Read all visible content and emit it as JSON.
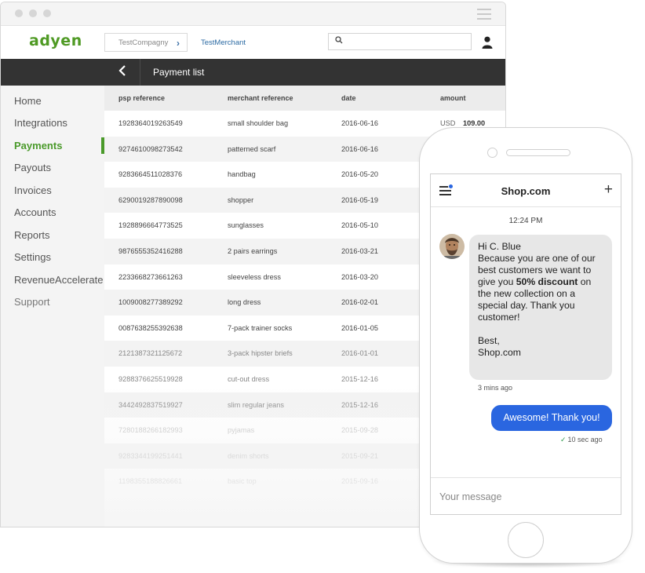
{
  "header": {
    "logo": "adyen",
    "company": "TestCompagny",
    "merchant": "TestMerchant",
    "search_value": "",
    "search_placeholder": ""
  },
  "page": {
    "title": "Payment list"
  },
  "sidebar": {
    "items": [
      {
        "label": "Home"
      },
      {
        "label": "Integrations"
      },
      {
        "label": "Payments"
      },
      {
        "label": "Payouts"
      },
      {
        "label": "Invoices"
      },
      {
        "label": "Accounts"
      },
      {
        "label": "Reports"
      },
      {
        "label": "Settings"
      },
      {
        "label": "RevenueAccelerate"
      },
      {
        "label": "Support"
      }
    ],
    "active_index": 2
  },
  "table": {
    "columns": [
      "psp reference",
      "merchant reference",
      "date",
      "amount"
    ],
    "rows": [
      {
        "psp": "1928364019263549",
        "ref": "small shoulder bag",
        "date": "2016-06-16",
        "currency": "USD",
        "amount": "109.00"
      },
      {
        "psp": "9274610098273542",
        "ref": "patterned scarf",
        "date": "2016-06-16"
      },
      {
        "psp": "9283664511028376",
        "ref": "handbag",
        "date": "2016-05-20"
      },
      {
        "psp": "6290019287890098",
        "ref": "shopper",
        "date": "2016-05-19"
      },
      {
        "psp": "1928896664773525",
        "ref": "sunglasses",
        "date": "2016-05-10"
      },
      {
        "psp": "9876555352416288",
        "ref": "2 pairs earrings",
        "date": "2016-03-21"
      },
      {
        "psp": "2233668273661263",
        "ref": "sleeveless dress",
        "date": "2016-03-20"
      },
      {
        "psp": "1009008277389292",
        "ref": "long dress",
        "date": "2016-02-01"
      },
      {
        "psp": "0087638255392638",
        "ref": "7-pack trainer socks",
        "date": "2016-01-05"
      },
      {
        "psp": "2121387321125672",
        "ref": "3-pack hipster briefs",
        "date": "2016-01-01"
      },
      {
        "psp": "9288376625519928",
        "ref": "cut-out dress",
        "date": "2015-12-16"
      },
      {
        "psp": "3442492837519927",
        "ref": "slim regular jeans",
        "date": "2015-12-16"
      },
      {
        "psp": "7280188266182993",
        "ref": "pyjamas",
        "date": "2015-09-28"
      },
      {
        "psp": "9283344199251441",
        "ref": "denim shorts",
        "date": "2015-09-21"
      },
      {
        "psp": "1198355188826661",
        "ref": "basic top",
        "date": "2015-09-16"
      }
    ]
  },
  "phone": {
    "title": "Shop.com",
    "time": "12:24 PM",
    "message_in": {
      "greeting": "Hi C. Blue",
      "text_before": "Because you are one of our best customers we want to give you ",
      "bold": "50% discount",
      "text_after": " on the new collection on a special day. Thank you customer!",
      "signoff": "Best,",
      "signature": "Shop.com",
      "ago": "3 mins ago"
    },
    "message_out": {
      "text": "Awesome! Thank you!",
      "ago": "10 sec ago"
    },
    "compose_placeholder": "Your message"
  },
  "colors": {
    "brand_green": "#4a9a2a",
    "dark_bar": "#333333",
    "chat_blue": "#2a66e0"
  }
}
